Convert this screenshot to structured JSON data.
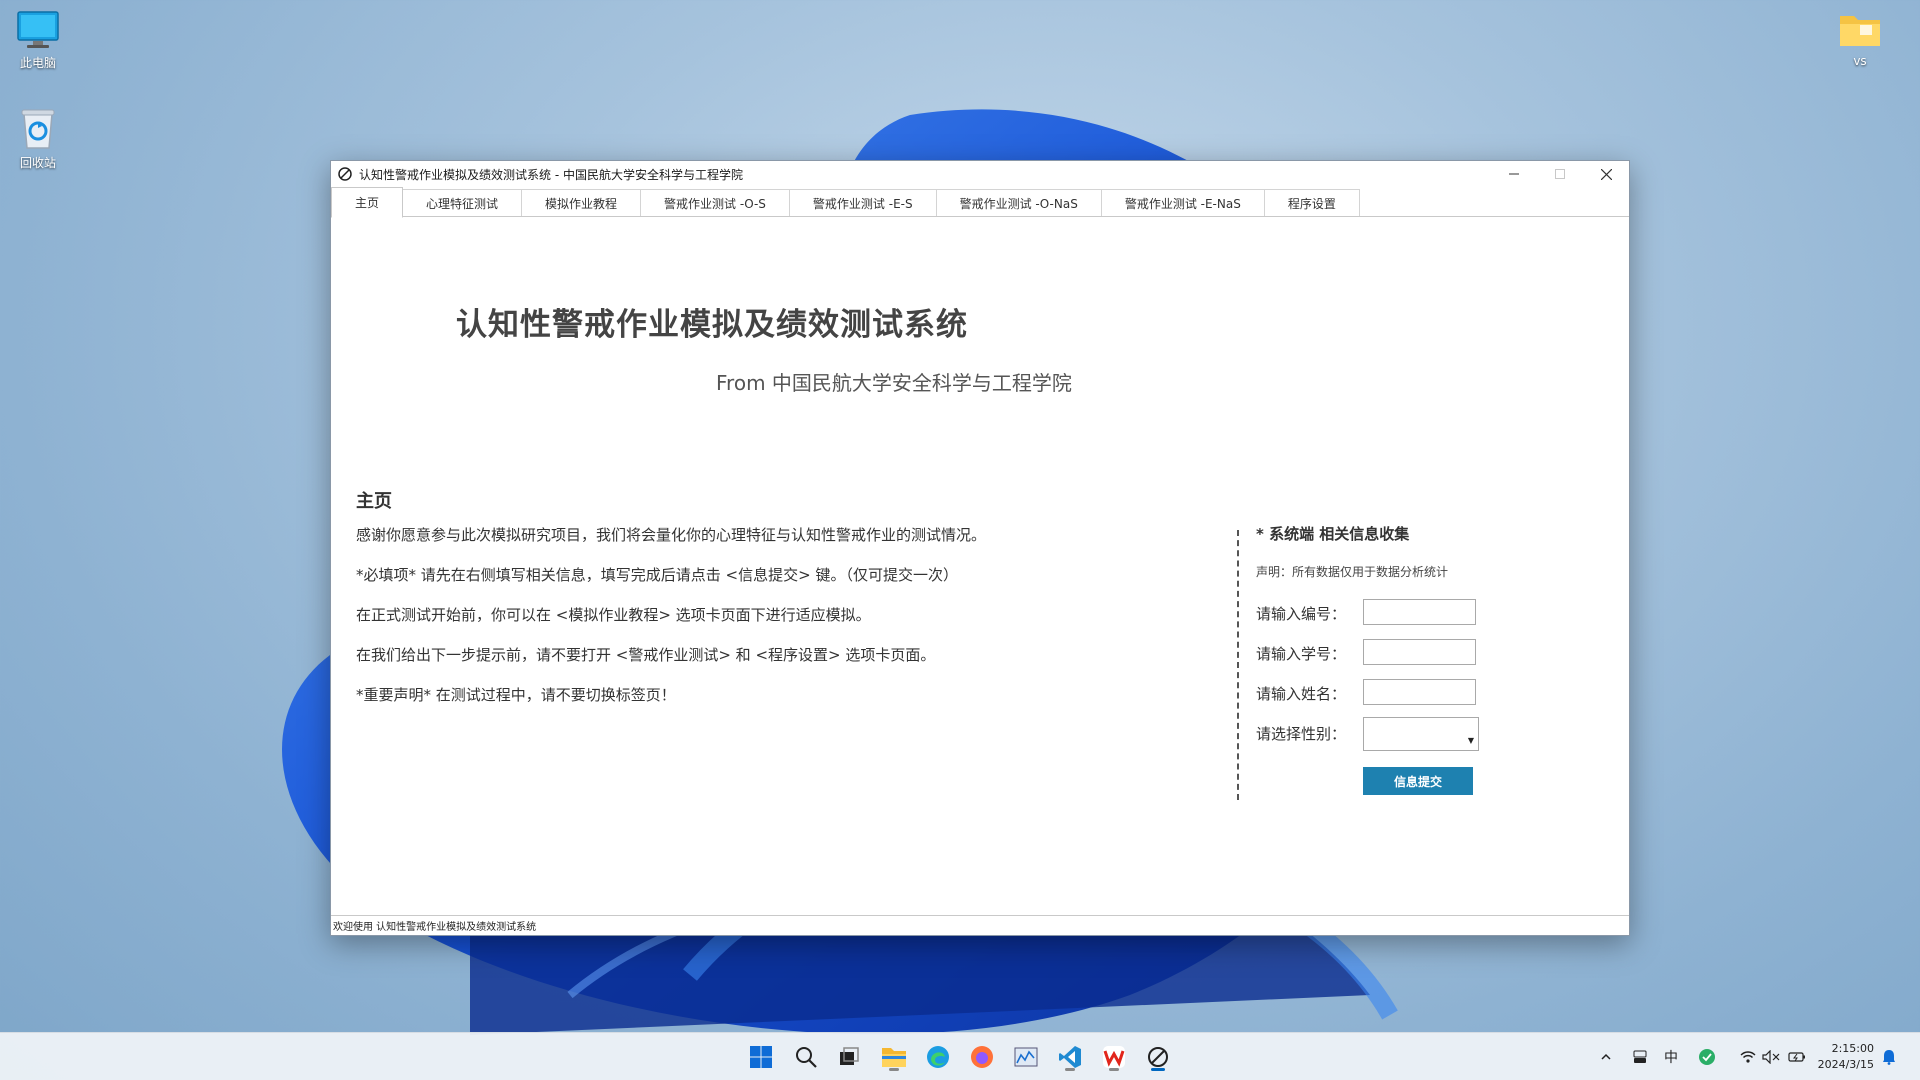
{
  "desktop": {
    "icons": [
      {
        "label": "此电脑"
      },
      {
        "label": "回收站"
      },
      {
        "label": "vs"
      }
    ]
  },
  "window": {
    "title": "认知性警戒作业模拟及绩效测试系统 - 中国民航大学安全科学与工程学院",
    "tabs": [
      {
        "label": "主页"
      },
      {
        "label": "心理特征测试"
      },
      {
        "label": "模拟作业教程"
      },
      {
        "label": "警戒作业测试 -O-S"
      },
      {
        "label": "警戒作业测试 -E-S"
      },
      {
        "label": "警戒作业测试 -O-NaS"
      },
      {
        "label": "警戒作业测试 -E-NaS"
      },
      {
        "label": "程序设置"
      }
    ],
    "active_tab": "主页",
    "main_title": "认知性警戒作业模拟及绩效测试系统",
    "sub_title": "From 中国民航大学安全科学与工程学院",
    "section_title": "主页",
    "paragraphs": [
      "感谢你愿意参与此次模拟研究项目，我们将会量化你的心理特征与认知性警戒作业的测试情况。",
      "*必填项* 请先在右侧填写相关信息，填写完成后请点击 <信息提交> 键。（仅可提交一次）",
      "在正式测试开始前，你可以在 <模拟作业教程> 选项卡页面下进行适应模拟。",
      "在我们给出下一步提示前，请不要打开 <警戒作业测试> 和 <程序设置> 选项卡页面。",
      "*重要声明* 在测试过程中，请不要切换标签页！"
    ],
    "form": {
      "title": "* 系统端 相关信息收集",
      "note": "声明：所有数据仅用于数据分析统计",
      "id_label": "请输入编号：",
      "id_value": "",
      "student_no_label": "请输入学号：",
      "student_no_value": "",
      "name_label": "请输入姓名：",
      "name_value": "",
      "gender_label": "请选择性别：",
      "gender_value": "",
      "submit_label": "信息提交"
    },
    "status_text": "欢迎使用 认知性警戒作业模拟及绩效测试系统"
  },
  "taskbar": {
    "ime": "中",
    "time": "2:15:00",
    "date": "2024/3/15"
  },
  "colors": {
    "accent": "#1e81b0",
    "taskbar_active": "#0067c0"
  }
}
